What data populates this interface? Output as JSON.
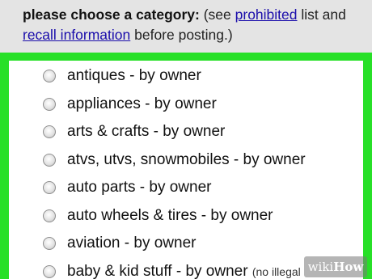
{
  "header": {
    "lead_bold": "please choose a category:",
    "lead_text": " (see ",
    "prohibited_link": "prohibited",
    "mid_text": " list and ",
    "recall_link": "recall information",
    "tail_text": " before posting.)"
  },
  "options": [
    {
      "label": "antiques - by owner",
      "note": ""
    },
    {
      "label": "appliances - by owner",
      "note": ""
    },
    {
      "label": "arts & crafts - by owner",
      "note": ""
    },
    {
      "label": "atvs, utvs, snowmobiles - by owner",
      "note": ""
    },
    {
      "label": "auto parts - by owner",
      "note": ""
    },
    {
      "label": "auto wheels & tires - by owner",
      "note": ""
    },
    {
      "label": "aviation - by owner",
      "note": ""
    },
    {
      "label": "baby & kid stuff - by owner ",
      "note": "(no illegal"
    }
  ],
  "watermark": {
    "wiki": "wiki",
    "how": "How"
  },
  "colors": {
    "frame_green": "#27e027",
    "link_blue": "#1a0dab"
  }
}
